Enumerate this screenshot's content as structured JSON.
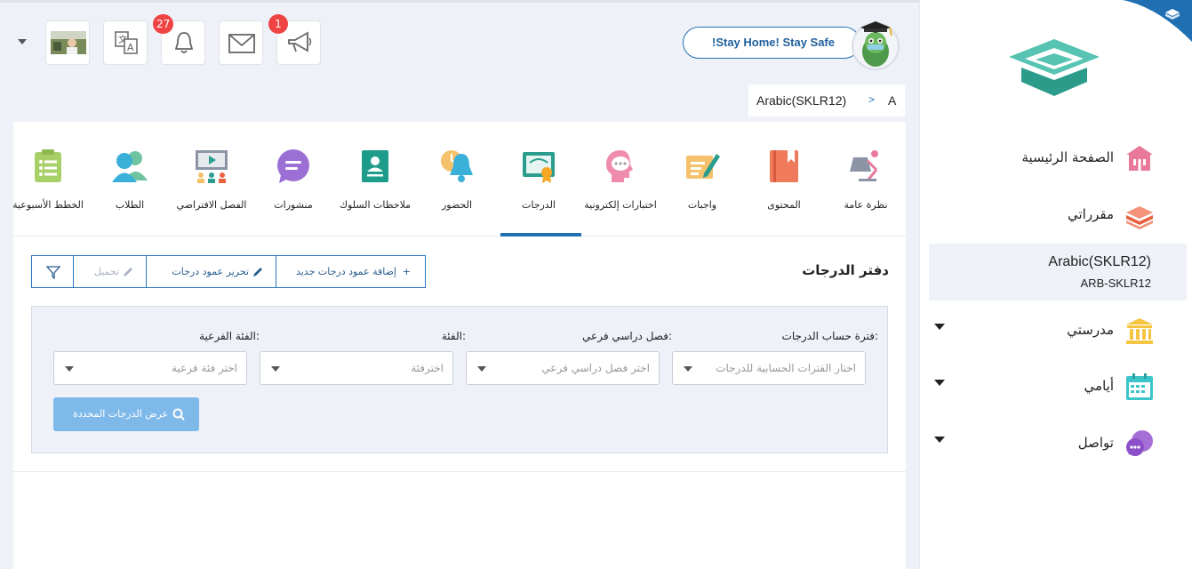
{
  "header": {
    "announcement": "!Stay Home! Stay Safe",
    "notifications_badge": "27",
    "announcements_badge": "1",
    "breadcrumb": {
      "course": "Arabic(SKLR12)",
      "separator": ">",
      "current": "A"
    }
  },
  "sidebar": {
    "items": [
      {
        "label": "الصفحة الرئيسية",
        "icon": "home-icon"
      },
      {
        "label": "مقرراتي",
        "icon": "books-icon"
      },
      {
        "label": "مدرستي",
        "icon": "school-icon"
      },
      {
        "label": "أيامي",
        "icon": "calendar-icon"
      },
      {
        "label": "تواصل",
        "icon": "chat-icon"
      }
    ],
    "active_course": {
      "name": "Arabic(SKLR12)",
      "code": "ARB-SKLR12"
    }
  },
  "tabs": [
    {
      "label": "نظرة عامة",
      "icon": "lamp-icon"
    },
    {
      "label": "المحتوى",
      "icon": "book-icon"
    },
    {
      "label": "واجبات",
      "icon": "assignment-icon"
    },
    {
      "label": "اختبارات إلكترونية",
      "icon": "quiz-head-icon"
    },
    {
      "label": "الدرجات",
      "icon": "certificate-icon"
    },
    {
      "label": "الحضور",
      "icon": "bell-clock-icon"
    },
    {
      "label": "ملاحظات السلوك",
      "icon": "behavior-notes-icon"
    },
    {
      "label": "منشورات",
      "icon": "speech-bubble-icon"
    },
    {
      "label": "الفصل الافتراضي",
      "icon": "virtual-class-icon"
    },
    {
      "label": "الطلاب",
      "icon": "students-icon"
    },
    {
      "label": "الخطط الأسبوعية",
      "icon": "clipboard-icon"
    }
  ],
  "active_tab": "الدرجات",
  "gradebook": {
    "title": "دفتر الدرجات",
    "actions": {
      "add_column": "إضافة عمود درجات جديد",
      "edit_column": "تحرير عمود درجات",
      "load": "تحميل"
    },
    "filters": [
      {
        "label": "فترة حساب الدرجات:",
        "placeholder": "اختار الفترات الحسابية للدرجات"
      },
      {
        "label": "فصل دراسي فرعي:",
        "placeholder": "اختر فصل دراسي فرعي"
      },
      {
        "label": "الفئة:",
        "placeholder": "اخترفئة"
      },
      {
        "label": "الفئة الفرعية:",
        "placeholder": "اختر فئة فرعية"
      }
    ],
    "show_button": "عرض الدرجات المحددة"
  },
  "colors": {
    "accent": "#1f6fb2",
    "sidebar_active": "#eef1f8",
    "badge": "#ef4444",
    "show_button": "#7fb9ea"
  }
}
